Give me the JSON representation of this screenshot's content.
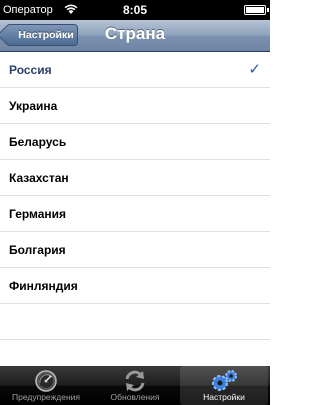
{
  "status_bar": {
    "carrier": "Оператор",
    "time": "8:05"
  },
  "nav": {
    "back_label": "Настройки",
    "title": "Страна"
  },
  "list": {
    "items": [
      {
        "label": "Россия",
        "selected": true
      },
      {
        "label": "Украина",
        "selected": false
      },
      {
        "label": "Беларусь",
        "selected": false
      },
      {
        "label": "Казахстан",
        "selected": false
      },
      {
        "label": "Германия",
        "selected": false
      },
      {
        "label": "Болгария",
        "selected": false
      },
      {
        "label": "Финляндия",
        "selected": false
      }
    ],
    "check": "✓"
  },
  "tabs": [
    {
      "label": "Предупреждения",
      "icon": "gauge-icon",
      "active": false
    },
    {
      "label": "Обновления",
      "icon": "refresh-icon",
      "active": false
    },
    {
      "label": "Настройки",
      "icon": "gears-icon",
      "active": true
    }
  ],
  "colors": {
    "selected_text": "#2b3f6b",
    "checkmark": "#2b5aa8",
    "nav_bar": "#7d93b0"
  }
}
